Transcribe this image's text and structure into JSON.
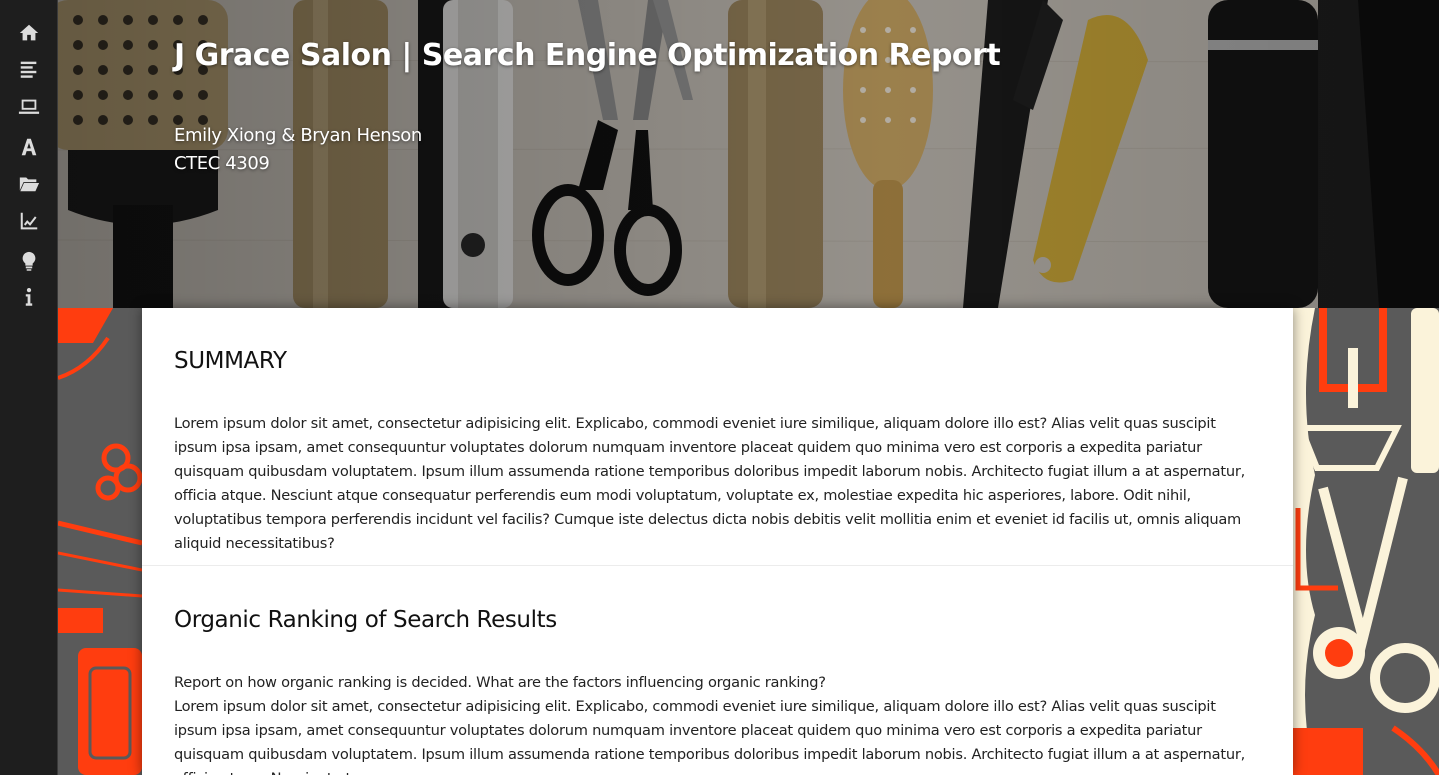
{
  "sidebar": {
    "items": [
      {
        "icon": "home-icon",
        "label": "Home"
      },
      {
        "icon": "list-icon",
        "label": "Summary"
      },
      {
        "icon": "laptop-icon",
        "label": "Search"
      },
      {
        "icon": "font-icon",
        "label": "Keywords"
      },
      {
        "icon": "folder-open-icon",
        "label": "Files"
      },
      {
        "icon": "line-chart-icon",
        "label": "Analytics"
      },
      {
        "icon": "lightbulb-icon",
        "label": "Recommendations"
      },
      {
        "icon": "info-icon",
        "label": "About"
      }
    ]
  },
  "hero": {
    "title": "J Grace Salon | Search Engine Optimization Report",
    "authors": "Emily Xiong & Bryan Henson",
    "course": "CTEC 4309"
  },
  "sections": [
    {
      "heading": "SUMMARY",
      "body": "Lorem ipsum dolor sit amet, consectetur adipisicing elit. Explicabo, commodi eveniet iure similique, aliquam dolore illo est? Alias velit quas suscipit ipsum ipsa ipsam, amet consequuntur voluptates dolorum numquam inventore placeat quidem quo minima vero est corporis a expedita pariatur quisquam quibusdam voluptatem. Ipsum illum assumenda ratione temporibus doloribus impedit laborum nobis. Architecto fugiat illum a at aspernatur, officia atque. Nesciunt atque consequatur perferendis eum modi voluptatum, voluptate ex, molestiae expedita hic asperiores, labore. Odit nihil, voluptatibus tempora perferendis incidunt vel facilis? Cumque iste delectus dicta nobis debitis velit mollitia enim et eveniet id facilis ut, omnis aliquam aliquid necessitatibus?"
    },
    {
      "heading": "Organic Ranking of Search Results",
      "lead": "Report on how organic ranking is decided. What are the factors influencing organic ranking?",
      "body": "Lorem ipsum dolor sit amet, consectetur adipisicing elit. Explicabo, commodi eveniet iure similique, aliquam dolore illo est? Alias velit quas suscipit ipsum ipsa ipsam, amet consequuntur voluptates dolorum numquam inventore placeat quidem quo minima vero est corporis a expedita pariatur quisquam quibusdam voluptatem. Ipsum illum assumenda ratione temporibus doloribus impedit laborum nobis. Architecto fugiat illum a at aspernatur, officia atque. Nesciunt atque"
    }
  ],
  "colors": {
    "sidebar": "#1e1e1e",
    "pattern_accent": "#ff3d0f",
    "pattern_cream": "#fbf3da",
    "pattern_base": "#5a5a5a"
  }
}
